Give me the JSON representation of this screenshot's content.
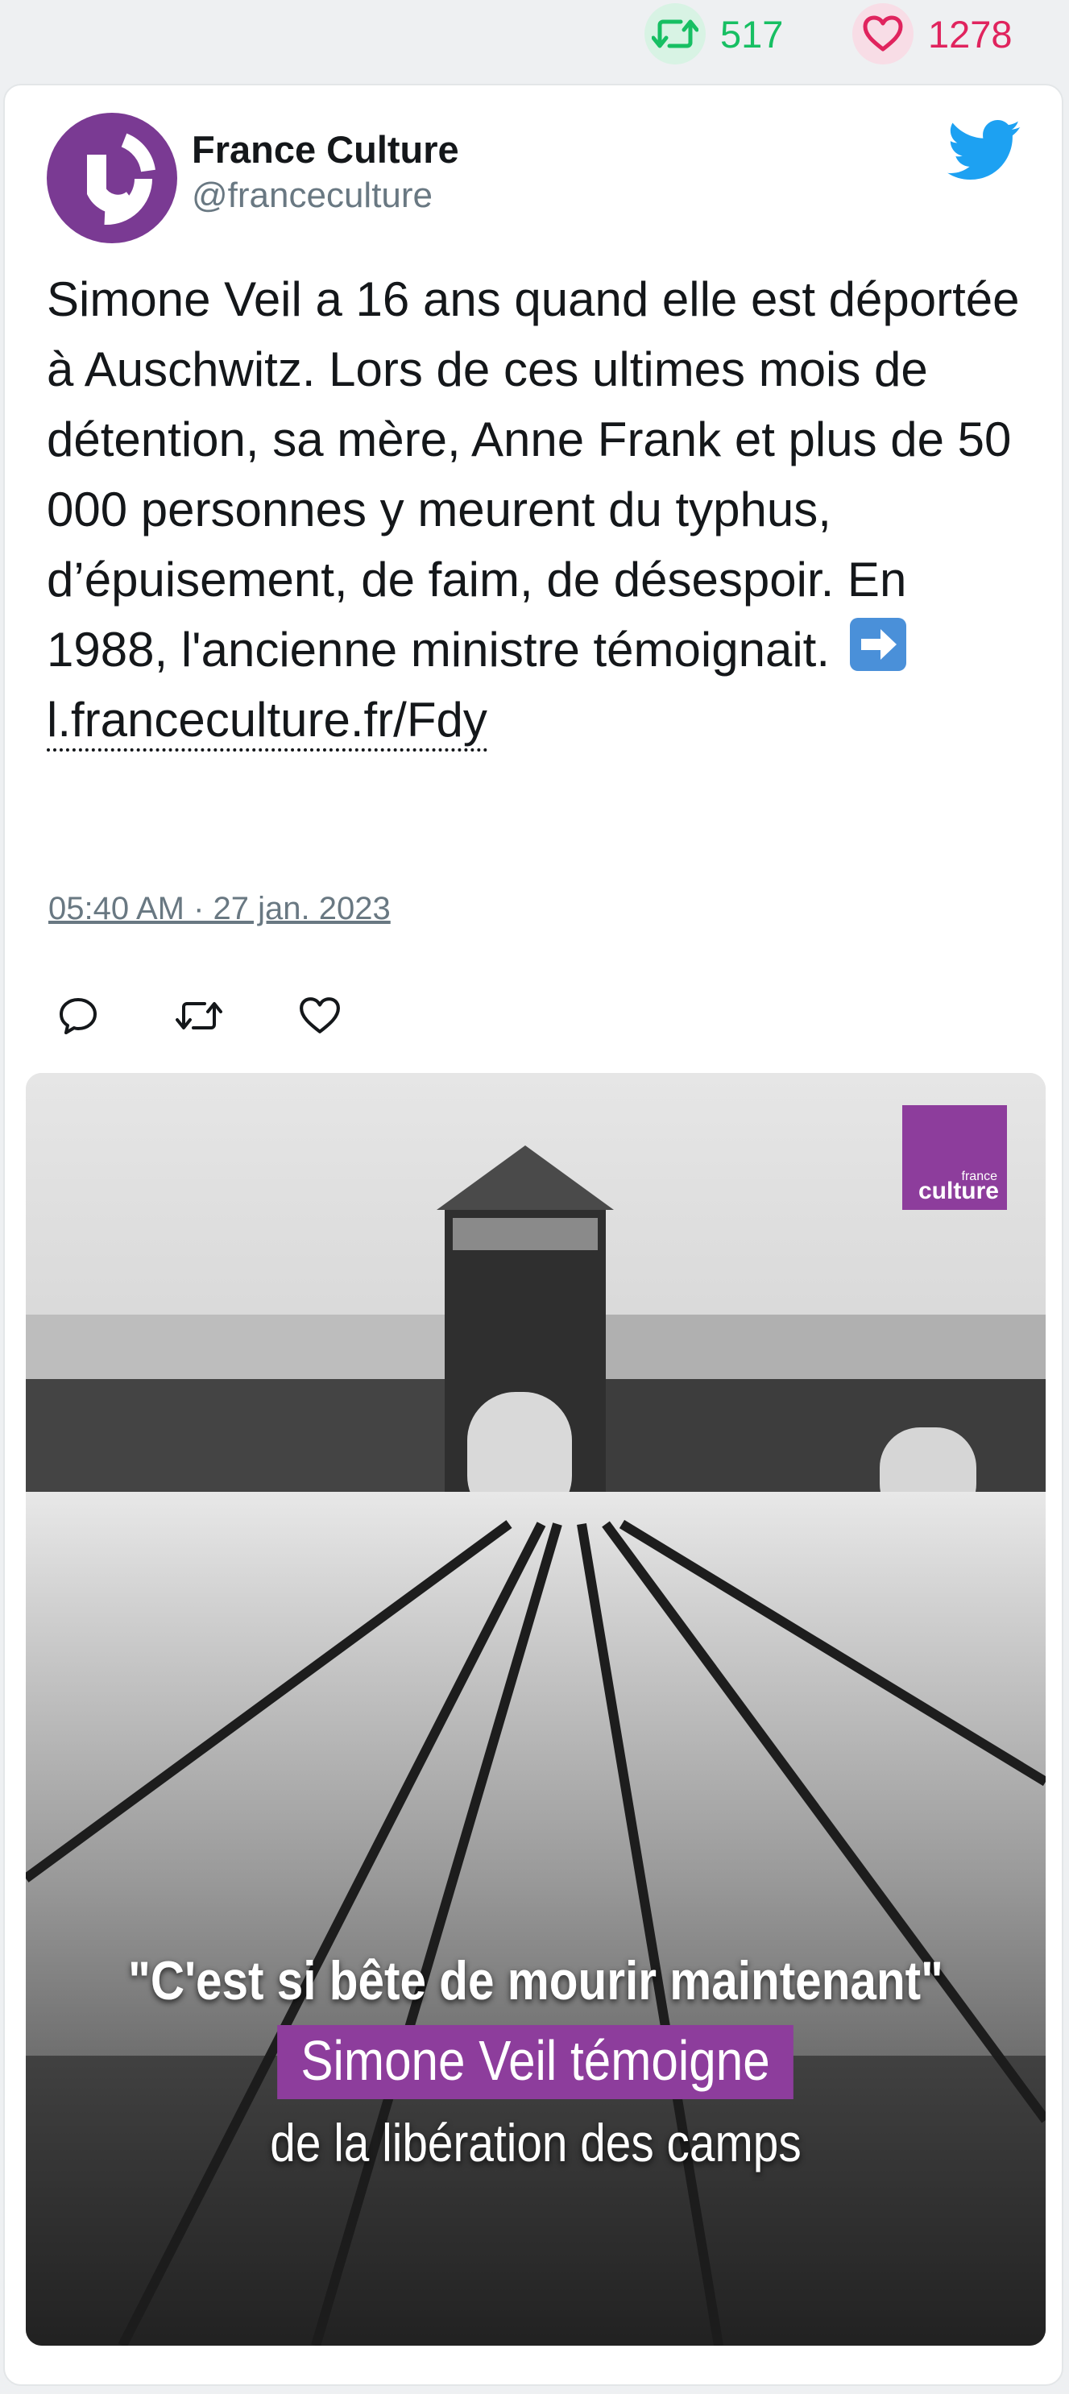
{
  "stats": {
    "retweets": "517",
    "likes": "1278"
  },
  "author": {
    "name": "France Culture",
    "handle": "@franceculture"
  },
  "tweet": {
    "text": "Simone Veil a 16 ans quand elle est déportée à Auschwitz. Lors de ces ultimes mois de détention, sa mère, Anne Frank et plus de 50 000 personnes y meurent du typhus, d’épuisement, de faim, de désespoir. En 1988, l'ancienne ministre témoignait.",
    "link": "l.franceculture.fr/Fdy",
    "timestamp": "05:40 AM · 27 jan. 2023"
  },
  "media": {
    "caption_line1": "\"C'est si bête de mourir maintenant\"",
    "caption_line2": "Simone Veil témoigne",
    "caption_line3": "de la libération des camps",
    "logo_small": "france",
    "logo_big": "culture"
  },
  "colors": {
    "retweet_green": "#17bf63",
    "like_red": "#e0245e",
    "twitter_blue": "#1da1f2",
    "brand_purple": "#8d3d9c"
  },
  "icons": {
    "retweet": "retweet-icon",
    "like": "heart-icon",
    "reply": "reply-icon",
    "twitter": "twitter-bird-icon"
  }
}
